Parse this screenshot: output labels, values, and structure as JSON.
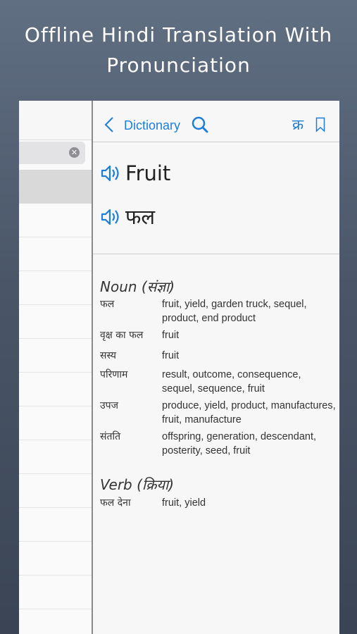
{
  "headline": {
    "line1": "Offline Hindi Translation With",
    "line2": "Pronunciation"
  },
  "nav": {
    "back_label": "Dictionary",
    "hindi_icon": "क्र"
  },
  "word": {
    "english": "Fruit",
    "hindi": "फल"
  },
  "noun": {
    "heading": "Noun (संज्ञा)",
    "entries": [
      {
        "hi": "फल",
        "en": "fruit, yield, garden truck, sequel, product, end product"
      },
      {
        "hi": "वृक्ष का फल",
        "en": "fruit"
      },
      {
        "hi": "सस्य",
        "en": "fruit"
      },
      {
        "hi": "परिणाम",
        "en": "result, outcome, consequence, sequel, sequence, fruit"
      },
      {
        "hi": "उपज",
        "en": "produce, yield, product, manufactures, fruit, manufacture"
      },
      {
        "hi": "संतति",
        "en": "offspring, generation, descendant, posterity, seed, fruit"
      }
    ]
  },
  "verb": {
    "heading": "Verb (क्रिया)",
    "entries": [
      {
        "hi": "फल देना",
        "en": "fruit, yield"
      }
    ]
  },
  "icons": {
    "back": "chevron-left-icon",
    "search": "search-icon",
    "hindi": "hindi-keyboard-icon",
    "bookmark": "bookmark-icon",
    "speaker": "speaker-icon",
    "clear": "clear-icon"
  },
  "colors": {
    "accent": "#1e7ed8"
  }
}
